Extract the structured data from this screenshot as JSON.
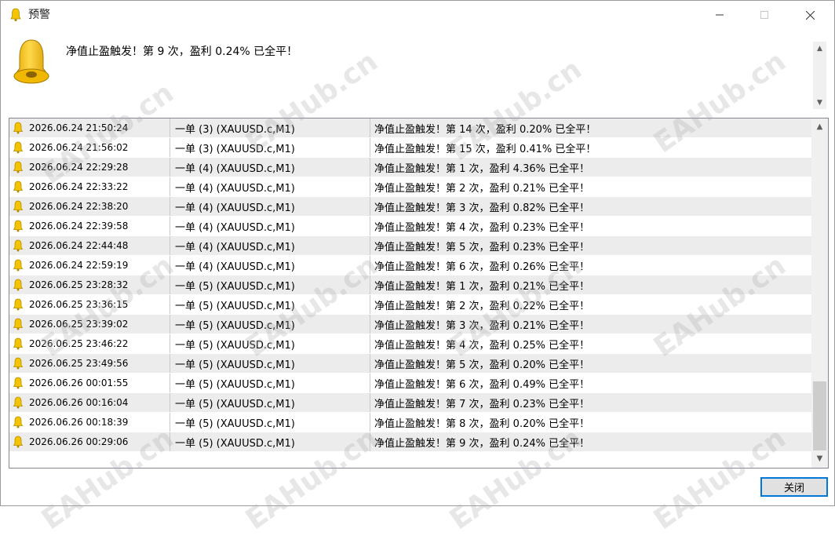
{
  "window": {
    "title": "预警"
  },
  "header": {
    "message": "净值止盈触发！第 9 次，盈利 0.24% 已全平！"
  },
  "alerts": [
    {
      "time": "2026.06.24 21:50:24",
      "symbol": "一单 (3) (XAUUSD.c,M1)",
      "message": "净值止盈触发！第 14 次，盈利 0.20% 已全平！"
    },
    {
      "time": "2026.06.24 21:56:02",
      "symbol": "一单 (3) (XAUUSD.c,M1)",
      "message": "净值止盈触发！第 15 次，盈利 0.41% 已全平！"
    },
    {
      "time": "2026.06.24 22:29:28",
      "symbol": "一单 (4) (XAUUSD.c,M1)",
      "message": "净值止盈触发！第 1 次，盈利 4.36% 已全平！"
    },
    {
      "time": "2026.06.24 22:33:22",
      "symbol": "一单 (4) (XAUUSD.c,M1)",
      "message": "净值止盈触发！第 2 次，盈利 0.21% 已全平！"
    },
    {
      "time": "2026.06.24 22:38:20",
      "symbol": "一单 (4) (XAUUSD.c,M1)",
      "message": "净值止盈触发！第 3 次，盈利 0.82% 已全平！"
    },
    {
      "time": "2026.06.24 22:39:58",
      "symbol": "一单 (4) (XAUUSD.c,M1)",
      "message": "净值止盈触发！第 4 次，盈利 0.23% 已全平！"
    },
    {
      "time": "2026.06.24 22:44:48",
      "symbol": "一单 (4) (XAUUSD.c,M1)",
      "message": "净值止盈触发！第 5 次，盈利 0.23% 已全平！"
    },
    {
      "time": "2026.06.24 22:59:19",
      "symbol": "一单 (4) (XAUUSD.c,M1)",
      "message": "净值止盈触发！第 6 次，盈利 0.26% 已全平！"
    },
    {
      "time": "2026.06.25 23:28:32",
      "symbol": "一单 (5) (XAUUSD.c,M1)",
      "message": "净值止盈触发！第 1 次，盈利 0.21% 已全平！"
    },
    {
      "time": "2026.06.25 23:36:15",
      "symbol": "一单 (5) (XAUUSD.c,M1)",
      "message": "净值止盈触发！第 2 次，盈利 0.22% 已全平！"
    },
    {
      "time": "2026.06.25 23:39:02",
      "symbol": "一单 (5) (XAUUSD.c,M1)",
      "message": "净值止盈触发！第 3 次，盈利 0.21% 已全平！"
    },
    {
      "time": "2026.06.25 23:46:22",
      "symbol": "一单 (5) (XAUUSD.c,M1)",
      "message": "净值止盈触发！第 4 次，盈利 0.25% 已全平！"
    },
    {
      "time": "2026.06.25 23:49:56",
      "symbol": "一单 (5) (XAUUSD.c,M1)",
      "message": "净值止盈触发！第 5 次，盈利 0.20% 已全平！"
    },
    {
      "time": "2026.06.26 00:01:55",
      "symbol": "一单 (5) (XAUUSD.c,M1)",
      "message": "净值止盈触发！第 6 次，盈利 0.49% 已全平！"
    },
    {
      "time": "2026.06.26 00:16:04",
      "symbol": "一单 (5) (XAUUSD.c,M1)",
      "message": "净值止盈触发！第 7 次，盈利 0.23% 已全平！"
    },
    {
      "time": "2026.06.26 00:18:39",
      "symbol": "一单 (5) (XAUUSD.c,M1)",
      "message": "净值止盈触发！第 8 次，盈利 0.20% 已全平！"
    },
    {
      "time": "2026.06.26 00:29:06",
      "symbol": "一单 (5) (XAUUSD.c,M1)",
      "message": "净值止盈触发！第 9 次，盈利 0.24% 已全平！"
    }
  ],
  "footer": {
    "close_label": "关闭"
  },
  "watermark": {
    "text": "EAHub.cn"
  },
  "icons": {
    "bell": "bell-icon"
  },
  "colors": {
    "bell": "#f5c400",
    "accent": "#0078d7",
    "row_alt": "#ececec"
  }
}
